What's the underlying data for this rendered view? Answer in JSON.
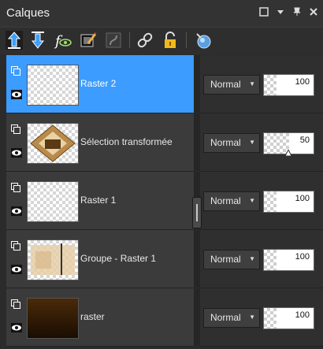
{
  "panel": {
    "title": "Calques"
  },
  "window_icons": [
    "restore-icon",
    "menu-arrow-icon",
    "pin-icon",
    "close-icon"
  ],
  "toolbar": {
    "tools": [
      "new-raster-layer-icon",
      "new-vector-layer-icon",
      "visibility-icon",
      "edit-mask-icon",
      "mask-icon",
      "link-icon",
      "lock-icon",
      "properties-icon"
    ]
  },
  "layers": [
    {
      "name": "Raster 2",
      "blend": "Normal",
      "opacity": "100",
      "opacity_fraction": 1.0,
      "selected": true,
      "thumb": "transparent"
    },
    {
      "name": "Sélection transformée",
      "blend": "Normal",
      "opacity": "50",
      "opacity_fraction": 0.5,
      "selected": false,
      "thumb": "image"
    },
    {
      "name": "Raster 1",
      "blend": "Normal",
      "opacity": "100",
      "opacity_fraction": 1.0,
      "selected": false,
      "thumb": "transparent"
    },
    {
      "name": "Groupe - Raster 1",
      "blend": "Normal",
      "opacity": "100",
      "opacity_fraction": 1.0,
      "selected": false,
      "thumb": "image-light"
    },
    {
      "name": "raster",
      "blend": "Normal",
      "opacity": "100",
      "opacity_fraction": 1.0,
      "selected": false,
      "thumb": "brown"
    }
  ],
  "colors": {
    "selection": "#3c9cff",
    "accent_arrow": "#3aa0ff",
    "lock": "#f2b91c"
  }
}
